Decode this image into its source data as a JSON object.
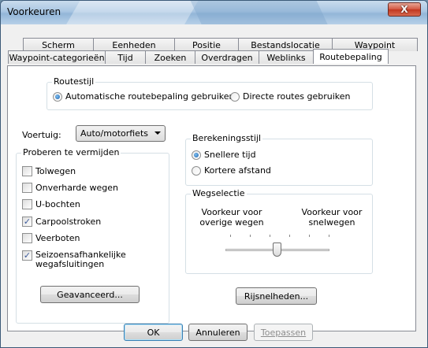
{
  "window": {
    "title": "Voorkeuren",
    "close_label": "X"
  },
  "tabs_row1": [
    "Scherm",
    "Eenheden",
    "Positie",
    "Bestandslocatie",
    "Waypoint"
  ],
  "tabs_row2": [
    "Waypoint-categorieën",
    "Tijd",
    "Zoeken",
    "Overdragen",
    "Weblinks",
    "Routebepaling"
  ],
  "active_tab": "Routebepaling",
  "routestijl": {
    "label": "Routestijl",
    "auto": "Automatische routebepaling gebruiken",
    "direct": "Directe routes gebruiken",
    "selected": "auto"
  },
  "voertuig": {
    "label": "Voertuig:",
    "value": "Auto/motorfiets"
  },
  "berekening": {
    "label": "Berekeningsstijl",
    "fast": "Snellere tijd",
    "short": "Kortere afstand",
    "selected": "fast"
  },
  "vermijden": {
    "label": "Proberen te vermijden",
    "items": [
      {
        "label": "Tolwegen",
        "checked": false
      },
      {
        "label": "Onverharde wegen",
        "checked": false
      },
      {
        "label": "U-bochten",
        "checked": false
      },
      {
        "label": "Carpoolstroken",
        "checked": true
      },
      {
        "label": "Veerboten",
        "checked": false
      },
      {
        "label": "Seizoensafhankelijke wegafsluitingen",
        "checked": true
      }
    ],
    "advanced": "Geavanceerd..."
  },
  "wegselectie": {
    "label": "Wegselectie",
    "left": "Voorkeur voor overige wegen",
    "right": "Voorkeur voor snelwegen",
    "level": 0.5
  },
  "rijsnelheden": "Rijsnelheden...",
  "footer": {
    "ok": "OK",
    "cancel": "Annuleren",
    "apply": "Toepassen"
  }
}
